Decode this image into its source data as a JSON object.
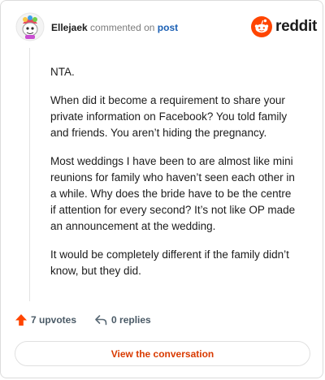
{
  "header": {
    "username": "Ellejaek",
    "commented_text": "commented on",
    "post_link": "post",
    "logo_word": "reddit"
  },
  "comment": {
    "paragraphs": [
      "NTA.",
      "When did it become a requirement to share your private information on Facebook? You told family and friends. You aren’t hiding the pregnancy.",
      "Most weddings I have been to are almost like mini reunions for family who haven’t seen each other in a while. Why does the bride have to be the centre if attention for every second? It’s not like OP made an announcement at the wedding.",
      "It would be completely different if the family didn’t know, but they did."
    ]
  },
  "actions": {
    "upvotes": "7 upvotes",
    "replies": "0 replies"
  },
  "cta": {
    "label": "View the conversation"
  },
  "colors": {
    "accent": "#FF4500",
    "link": "#1a5fb4",
    "cta_text": "#d93a00"
  },
  "icons": [
    "avatar",
    "reddit-logo-icon",
    "upvote-arrow-icon",
    "reply-arrow-icon"
  ]
}
